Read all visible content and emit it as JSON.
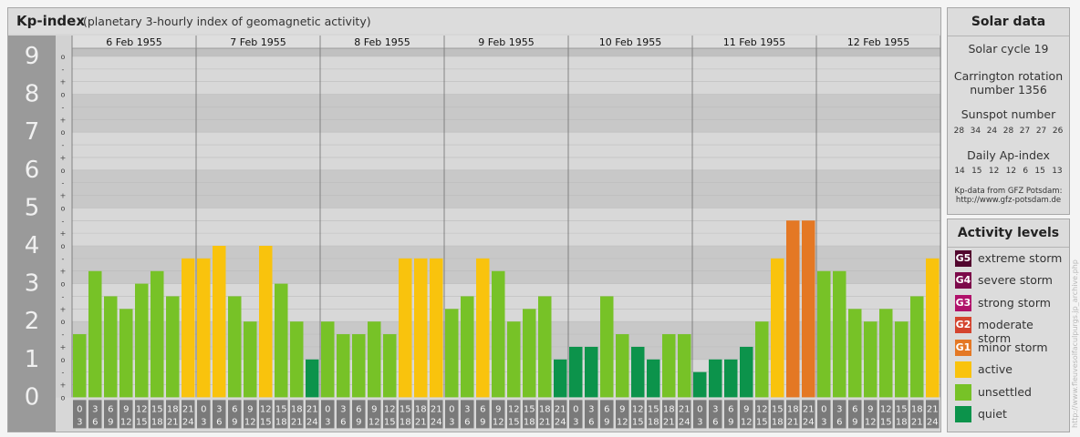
{
  "chart": {
    "title": "Kp-index",
    "subtitle": "(planetary 3-hourly index of geomagnetic activity)"
  },
  "solar": {
    "title": "Solar data",
    "cycle_text": "Solar cycle 19",
    "carrington_line1": "Carrington rotation",
    "carrington_line2": "number 1356",
    "sunspot_label": "Sunspot number",
    "sunspot_values": [
      "28",
      "34",
      "24",
      "28",
      "27",
      "27",
      "26"
    ],
    "ap_label": "Daily Ap-index",
    "ap_values": [
      "14",
      "15",
      "12",
      "12",
      "6",
      "15",
      "13"
    ],
    "credit_line1": "Kp-data from GFZ Potsdam:",
    "credit_line2": "http://www.gfz-potsdam.de"
  },
  "levels": {
    "title": "Activity levels",
    "items": [
      {
        "badge": "G5",
        "label": "extreme storm",
        "color": "#52062e"
      },
      {
        "badge": "G4",
        "label": "severe storm",
        "color": "#7c0a4a"
      },
      {
        "badge": "G3",
        "label": "strong storm",
        "color": "#b0126a"
      },
      {
        "badge": "G2",
        "label": "moderate storm",
        "color": "#d4442e"
      },
      {
        "badge": "G1",
        "label": "minor storm",
        "color": "#e47824"
      },
      {
        "badge": "",
        "label": "active",
        "color": "#f9c30d"
      },
      {
        "badge": "",
        "label": "unsettled",
        "color": "#77c227"
      },
      {
        "badge": "",
        "label": "quiet",
        "color": "#0c934b"
      }
    ]
  },
  "watermark": "http://www.fleuvesolfaculpurgs.jp_archive.php",
  "chart_data": {
    "type": "bar",
    "title": "Kp-index",
    "subtitle": "(planetary 3-hourly index of geomagnetic activity)",
    "ylim": [
      0,
      9
    ],
    "y_ticks": [
      "0",
      "1",
      "2",
      "3",
      "4",
      "5",
      "6",
      "7",
      "8",
      "9"
    ],
    "subdivision_labels": [
      "o",
      "+",
      "-"
    ],
    "days": [
      "6 Feb 1955",
      "7 Feb 1955",
      "8 Feb 1955",
      "9 Feb 1955",
      "10 Feb 1955",
      "11 Feb 1955",
      "12 Feb 1955"
    ],
    "interval_start": [
      "0",
      "3",
      "6",
      "9",
      "12",
      "15",
      "18",
      "21"
    ],
    "interval_end": [
      "3",
      "6",
      "9",
      "12",
      "15",
      "18",
      "21",
      "24"
    ],
    "values": [
      [
        1.667,
        3.333,
        2.667,
        2.333,
        3.0,
        3.333,
        2.667,
        3.667
      ],
      [
        3.667,
        4.0,
        2.667,
        2.0,
        4.0,
        3.0,
        2.0,
        1.0
      ],
      [
        2.0,
        1.667,
        1.667,
        2.0,
        1.667,
        3.667,
        3.667,
        3.667
      ],
      [
        2.333,
        2.667,
        3.667,
        3.333,
        2.0,
        2.333,
        2.667,
        1.0
      ],
      [
        1.333,
        1.333,
        2.667,
        1.667,
        1.333,
        1.0,
        1.667,
        1.667
      ],
      [
        0.667,
        1.0,
        1.0,
        1.333,
        2.0,
        3.667,
        4.667,
        4.667
      ],
      [
        3.333,
        3.333,
        2.333,
        2.0,
        2.333,
        2.0,
        2.667,
        3.667
      ]
    ],
    "colors": {
      "quiet": "#0c934b",
      "unsettled": "#77c227",
      "active": "#f9c30d",
      "minor": "#e47824"
    },
    "legend": "right"
  }
}
